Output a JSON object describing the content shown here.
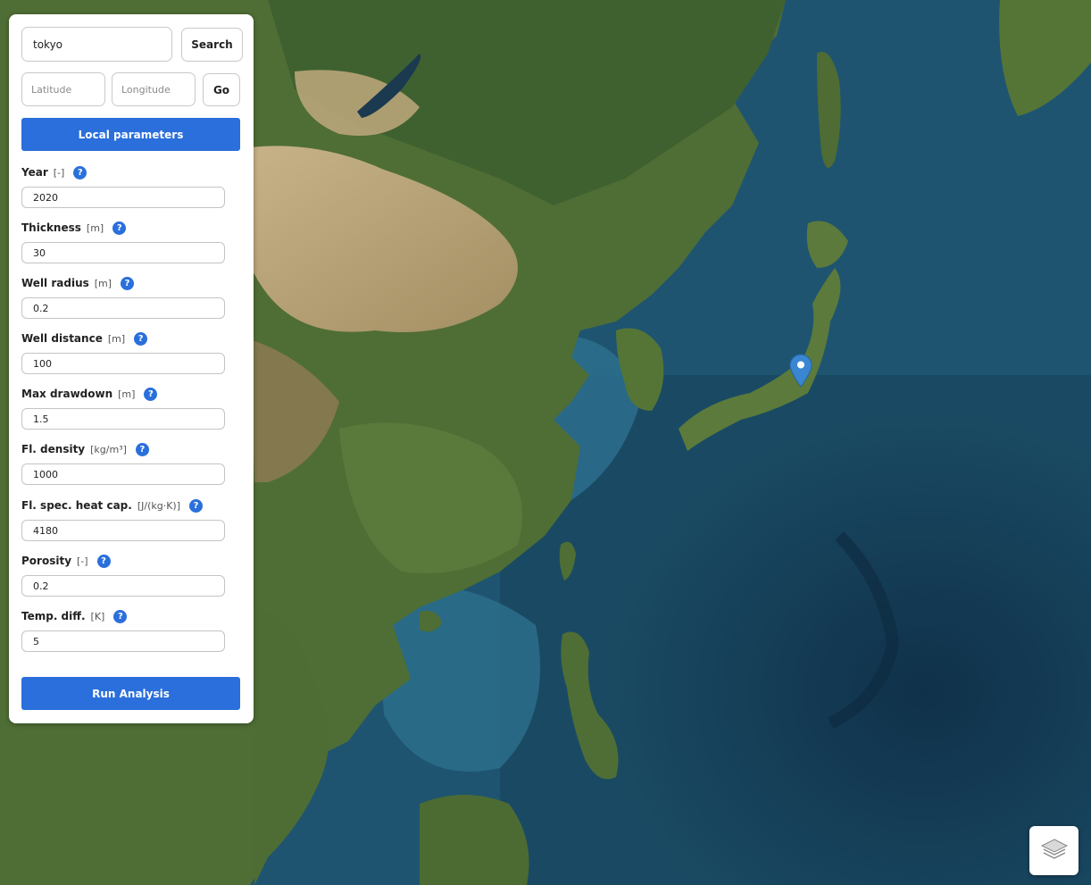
{
  "search": {
    "value": "tokyo",
    "button_label": "Search"
  },
  "coordinates": {
    "latitude_placeholder": "Latitude",
    "longitude_placeholder": "Longitude",
    "go_label": "Go"
  },
  "local_parameters_label": "Local parameters",
  "parameters": [
    {
      "name": "Year",
      "unit": "[-]",
      "value": "2020"
    },
    {
      "name": "Thickness",
      "unit": "[m]",
      "value": "30"
    },
    {
      "name": "Well radius",
      "unit": "[m]",
      "value": "0.2"
    },
    {
      "name": "Well distance",
      "unit": "[m]",
      "value": "100"
    },
    {
      "name": "Max drawdown",
      "unit": "[m]",
      "value": "1.5"
    },
    {
      "name": "Fl. density",
      "unit": "[kg/m³]",
      "value": "1000"
    },
    {
      "name": "Fl. spec. heat cap.",
      "unit": "[J/(kg·K)]",
      "value": "4180"
    },
    {
      "name": "Porosity",
      "unit": "[-]",
      "value": "0.2"
    },
    {
      "name": "Temp. diff.",
      "unit": "[K]",
      "value": "5"
    }
  ],
  "help_glyph": "?",
  "run_label": "Run Analysis",
  "icons": {
    "help": "help-icon",
    "marker": "map-marker-icon",
    "layers": "layers-icon"
  },
  "colors": {
    "accent": "#2a6fdb",
    "ocean": "#1d4f6a",
    "land": "#4f6e35"
  }
}
